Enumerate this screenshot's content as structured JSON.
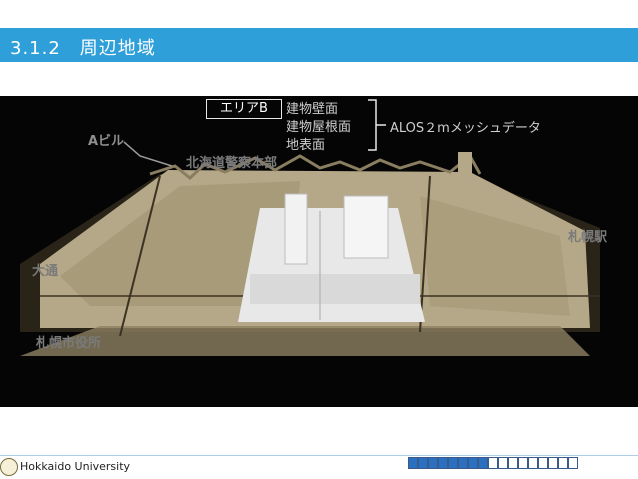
{
  "header": {
    "title": "3.1.2　周辺地域"
  },
  "figure": {
    "area_b": "エリアB",
    "layers": [
      "建物壁面",
      "建物屋根面",
      "地表面"
    ],
    "dataset": "ALOS２mメッシュデータ",
    "labels": {
      "a_building": "Aビル",
      "police": "北海道警察本部",
      "station": "札幌駅",
      "odori": "大通",
      "city_hall": "札幌市役所"
    }
  },
  "footer": {
    "org": "Hokkaido University"
  },
  "pager": {
    "total": 17,
    "current": 8
  },
  "colors": {
    "accent": "#2e9fd8",
    "terrain": "#b5a888",
    "area_white": "#e8e8e8",
    "pager_on": "#2a6fc0"
  }
}
